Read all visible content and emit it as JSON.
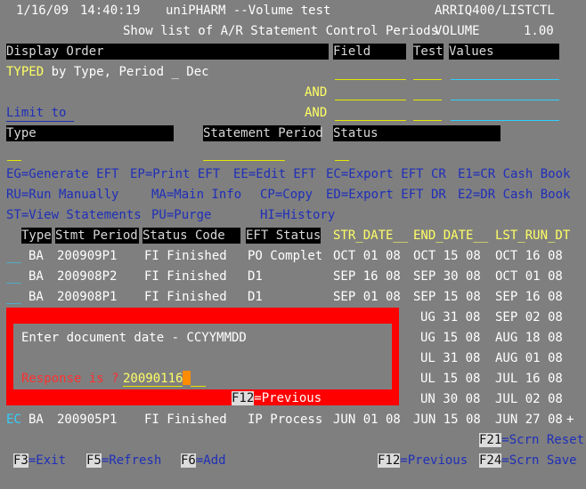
{
  "header": {
    "date": "1/16/09",
    "time": "14:40:19",
    "app": "uniPHARM --Volume test",
    "program": "ARRIQ400/LISTCTL",
    "subtitle": "Show list of A/R Statement Control Periods",
    "volume_label": "VOLUME",
    "version": "1.00"
  },
  "filters": {
    "display_order_label": "Display Order",
    "field_label": "Field",
    "test_label": "Test",
    "values_label": "Values",
    "typed_keyword": "TYPED",
    "typed_rest": " by Type, Period _ Dec",
    "and1": "AND",
    "and2": "AND",
    "limit_to": "Limit to ",
    "type_label": "Type",
    "stmt_period_label": "Statement Period",
    "status_label": "Status"
  },
  "commands": {
    "eg": "EG=Generate EFT",
    "ep": "EP=Print EFT",
    "ee": "EE=Edit EFT",
    "ec": "EC=Export EFT CR",
    "e1": "E1=CR Cash Book",
    "ru": "RU=Run Manually",
    "ma": "MA=Main Info",
    "cp": "CP=Copy",
    "ed": "ED=Export EFT DR",
    "e2": "E2=DR Cash Book",
    "st": "ST=View Statements",
    "pu": "PU=Purge",
    "hi": "HI=History"
  },
  "table": {
    "headers": {
      "type": "Type",
      "stmt_period": "Stmt Period",
      "status_code": "Status Code",
      "eft_status": "EFT Status",
      "str_date": "STR_DATE__",
      "end_date": "END_DATE__",
      "lst_run": "LST_RUN_DT"
    },
    "rows": [
      {
        "sel": "__",
        "type": "BA",
        "period": "200909P1",
        "status": "FI Finished",
        "eft": "PO Complet",
        "str": "OCT 01 08",
        "end": "OCT 15 08",
        "lst": "OCT 16 08"
      },
      {
        "sel": "__",
        "type": "BA",
        "period": "200908P2",
        "status": "FI Finished",
        "eft": "D1",
        "str": "SEP 16 08",
        "end": "SEP 30 08",
        "lst": "OCT 01 08"
      },
      {
        "sel": "__",
        "type": "BA",
        "period": "200908P1",
        "status": "FI Finished",
        "eft": "D1",
        "str": "SEP 01 08",
        "end": "SEP 15 08",
        "lst": "SEP 16 08"
      },
      {
        "end": "UG 31 08",
        "lst": "SEP 02 08"
      },
      {
        "end": "UG 15 08",
        "lst": "AUG 18 08"
      },
      {
        "end": "UL 31 08",
        "lst": "AUG 01 08"
      },
      {
        "end": "UL 15 08",
        "lst": "JUL 16 08"
      },
      {
        "end": "UN 30 08",
        "lst": "JUL 02 08"
      },
      {
        "sel": "EC",
        "type": "BA",
        "period": "200905P1",
        "status": "FI Finished",
        "eft": "IP Process",
        "str": "JUN 01 08",
        "end": "JUN 15 08",
        "lst": "JUN 27 08",
        "more": "+"
      }
    ]
  },
  "popup": {
    "prompt": "Enter document date - CCYYMMDD",
    "response_label": "Response is ?",
    "response_value": "20090116",
    "f12_key": "F12",
    "f12_label": "=Previous"
  },
  "fkeys": {
    "f21_key": "F21",
    "f21_label": "=Scrn Reset",
    "f3_key": "F3",
    "f3_label": "=Exit",
    "f5_key": "F5",
    "f5_label": "=Refresh",
    "f6_key": "F6",
    "f6_label": "=Add",
    "f12_key": "F12",
    "f12_label": "=Previous",
    "f24_key": "F24",
    "f24_label": "=Scrn Save"
  }
}
